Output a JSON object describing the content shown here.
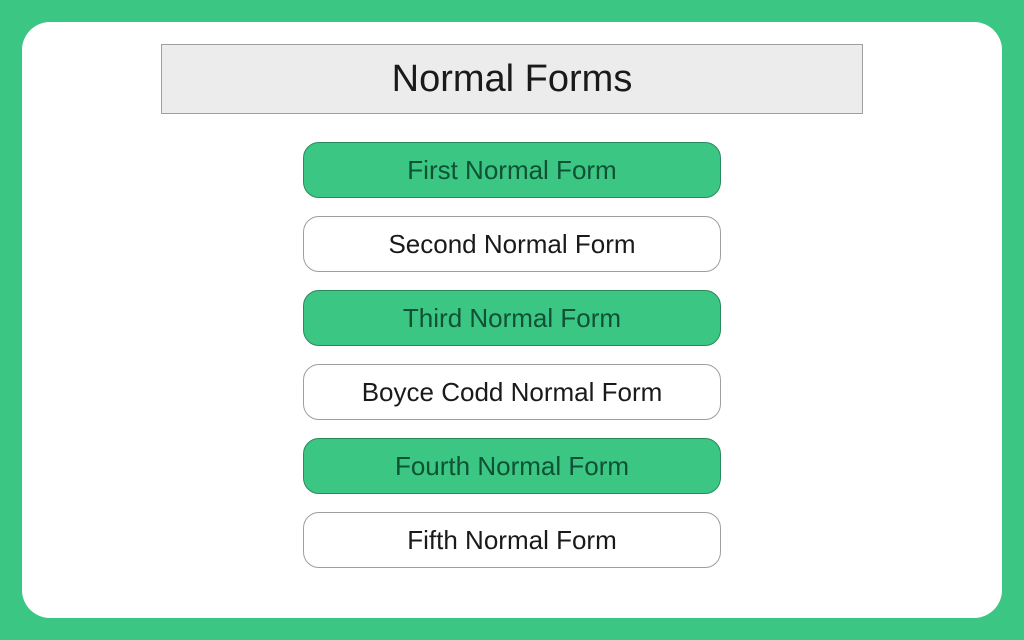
{
  "title": "Normal Forms",
  "items": [
    {
      "label": "First Normal Form",
      "style": "filled"
    },
    {
      "label": "Second Normal Form",
      "style": "outline"
    },
    {
      "label": "Third Normal Form",
      "style": "filled"
    },
    {
      "label": "Boyce Codd Normal Form",
      "style": "outline"
    },
    {
      "label": "Fourth Normal Form",
      "style": "filled"
    },
    {
      "label": "Fifth Normal Form",
      "style": "outline"
    }
  ],
  "colors": {
    "accent": "#3bc683",
    "titleBg": "#ececec",
    "border": "#9e9e9e",
    "textDark": "#1a1a1a",
    "textOnAccent": "#0f5134"
  }
}
